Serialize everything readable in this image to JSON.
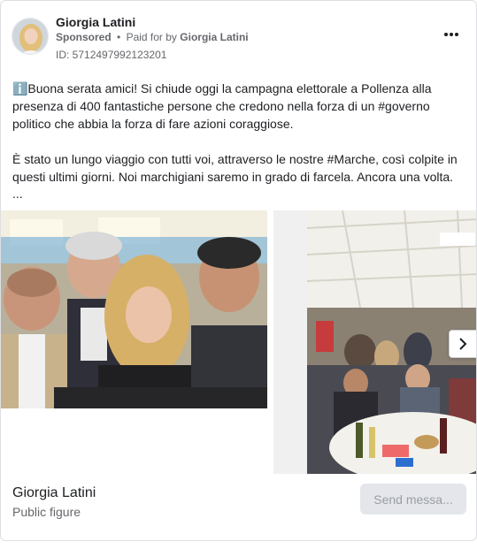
{
  "post": {
    "page_name": "Giorgia Latini",
    "sponsored_label": "Sponsored",
    "separator": "•",
    "paid_for_prefix": "Paid for by",
    "paid_for_name": "Giorgia Latini",
    "ad_id": "ID: 5712497992123201",
    "more_icon": "more-horizontal-icon",
    "text": "ℹ️Buona serata amici! Si chiude oggi la campagna elettorale a Pollenza alla presenza di 400 fantastiche persone che credono nella forza di un #governo politico che abbia la forza di fare azioni coraggiose.\n\nÈ stato un lungo viaggio con tutti voi, attraverso le nostre #Marche, così colpite in questi ultimi giorni. Noi marchigiani saremo in grado di farcela. Ancora una volta.",
    "ellipsis": "..."
  },
  "carousel": {
    "next_icon": "chevron-right-icon"
  },
  "footer": {
    "name": "Giorgia Latini",
    "category": "Public figure",
    "cta_label": "Send messa..."
  },
  "colors": {
    "text": "#1c1e21",
    "secondary": "#65676b",
    "button_bg": "#e4e6eb",
    "button_text": "#9a9ea5"
  }
}
